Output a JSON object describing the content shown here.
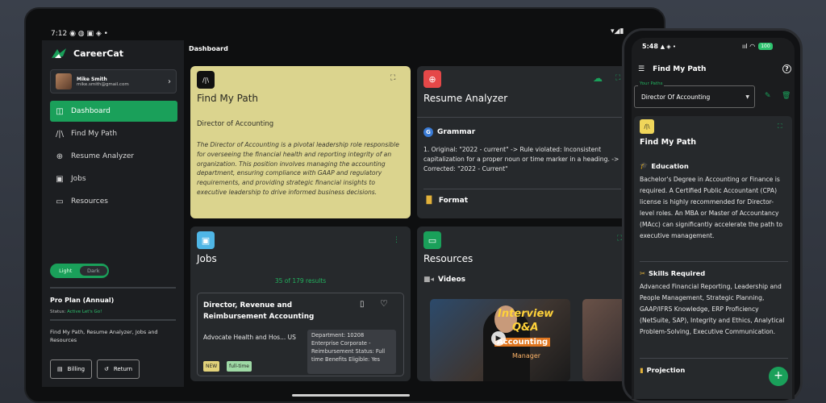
{
  "tablet": {
    "status_left": "7:12 ◉ ◍ ▣ ◈ •",
    "status_right": "▾◢▮"
  },
  "sidebar": {
    "brand": "CareerCat",
    "user": {
      "name": "Mike Smith",
      "email": "mike.smith@gmail.com"
    },
    "nav": [
      {
        "label": "Dashboard",
        "icon": "dashboard-icon"
      },
      {
        "label": "Find My Path",
        "icon": "path-icon"
      },
      {
        "label": "Resume Analyzer",
        "icon": "resume-analyzer-icon"
      },
      {
        "label": "Jobs",
        "icon": "jobs-icon"
      },
      {
        "label": "Resources",
        "icon": "resources-icon"
      }
    ],
    "theme": {
      "light": "Light",
      "dark": "Dark"
    },
    "plan": {
      "title": "Pro Plan (Annual)",
      "status_label": "Status:",
      "status_value": "Active",
      "status_note": "Let's Go!",
      "description": "Find My Path, Resume Analyzer, Jobs and Resources"
    },
    "billing_label": "Billing",
    "return_label": "Return"
  },
  "main": {
    "header": "Dashboard",
    "find": {
      "title": "Find My Path",
      "role": "Director of Accounting",
      "description": "The Director of Accounting is a pivotal leadership role responsible for overseeing the financial health and reporting integrity of an organization. This position involves managing the accounting department, ensuring compliance with GAAP and regulatory requirements, and providing strategic financial insights to executive leadership to drive informed business decisions."
    },
    "resume": {
      "title": "Resume Analyzer",
      "grammar_label": "Grammar",
      "grammar_badge": "G",
      "grammar_text": "1. Original: \"2022 - current\" -> Rule violated: Inconsistent capitalization for a proper noun or time marker in a heading. -> Corrected: \"2022 - Current\"",
      "format_label": "Format"
    },
    "jobs": {
      "title": "Jobs",
      "results": "35 of 179 results",
      "job": {
        "title": "Director, Revenue and Reimbursement Accounting",
        "company": "Advocate Health and Hos... US",
        "details": "Department: 10208 Enterprise Corporate - Reimbursement Status: Full time Benefits Eligible: Yes",
        "tags": [
          "NEW",
          "full-time"
        ]
      }
    },
    "resources": {
      "title": "Resources",
      "videos_label": "Videos",
      "video_overlay_1": "Interview",
      "video_overlay_2": "Q&A",
      "video_overlay_3": "Accounting",
      "video_overlay_4": "Manager"
    }
  },
  "phone": {
    "status_time": "5:48",
    "status_icons": "▲ ◈ •",
    "status_right": "ııl ◠",
    "battery": "100",
    "header": "Find My Path",
    "select": {
      "label": "Your Paths",
      "value": "Director Of Accounting"
    },
    "card_title": "Find My Path",
    "education_title": "Education",
    "education_text": "Bachelor's Degree in Accounting or Finance is required. A Certified Public Accountant (CPA) license is highly recommended for Director-level roles. An MBA or Master of Accountancy (MAcc) can significantly accelerate the path to executive management.",
    "skills_title": "Skills Required",
    "skills_text": "Advanced Financial Reporting, Leadership and People Management, Strategic Planning, GAAP/IFRS Knowledge, ERP Proficiency (NetSuite, SAP), Integrity and Ethics, Analytical Problem-Solving, Executive Communication.",
    "projection_title": "Projection",
    "fab": "+"
  },
  "colors": {
    "accent": "#1aa05a",
    "find_card": "#dbd48e",
    "card_bg": "#26292c"
  }
}
